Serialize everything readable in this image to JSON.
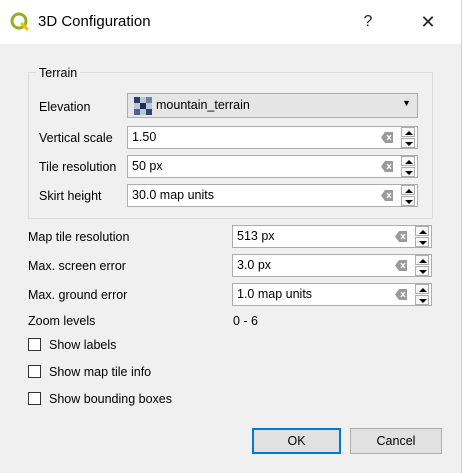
{
  "window": {
    "title": "3D Configuration",
    "help_label": "?",
    "close_label": "✕"
  },
  "terrain": {
    "group_title": "Terrain",
    "elevation_label": "Elevation",
    "elevation_value": "mountain_terrain",
    "vertical_scale_label": "Vertical scale",
    "vertical_scale_value": "1.50",
    "tile_resolution_label": "Tile resolution",
    "tile_resolution_value": "50 px",
    "skirt_height_label": "Skirt height",
    "skirt_height_value": "30.0 map units"
  },
  "map": {
    "map_tile_resolution_label": "Map tile resolution",
    "map_tile_resolution_value": "513 px",
    "max_screen_error_label": "Max. screen error",
    "max_screen_error_value": "3.0 px",
    "max_ground_error_label": "Max. ground error",
    "max_ground_error_value": "1.0 map units",
    "zoom_levels_label": "Zoom levels",
    "zoom_levels_value": "0 - 6"
  },
  "checkboxes": {
    "show_labels": "Show labels",
    "show_map_tile_info": "Show map tile info",
    "show_bounding_boxes": "Show bounding boxes"
  },
  "buttons": {
    "ok": "OK",
    "cancel": "Cancel"
  },
  "colors": {
    "accent": "#0078d7",
    "qgis_green": "#93b023"
  }
}
